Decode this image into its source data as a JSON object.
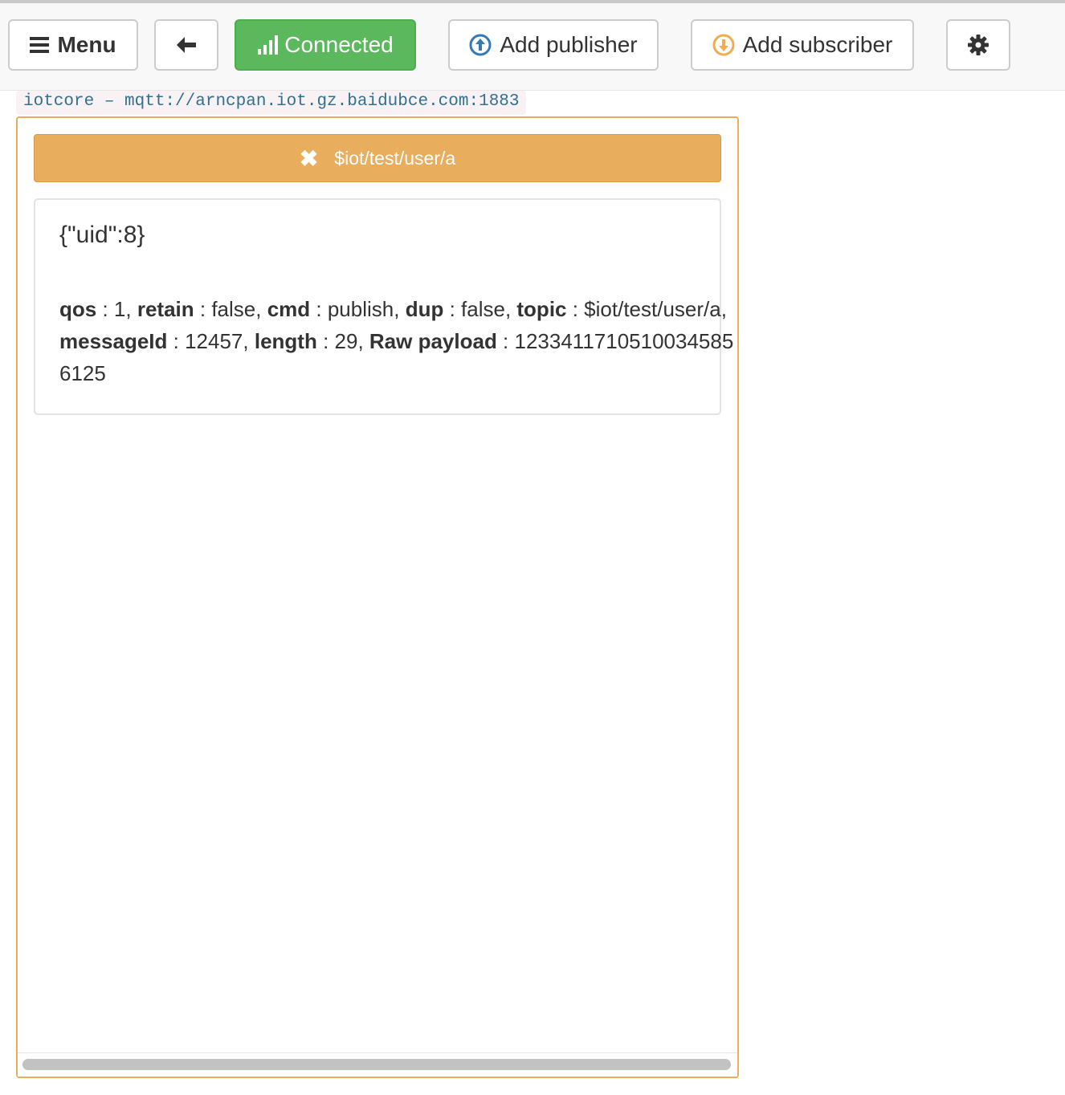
{
  "toolbar": {
    "menu_label": "Menu",
    "back_icon": "arrow-left-icon",
    "connected_label": "Connected",
    "add_publisher_label": "Add publisher",
    "add_subscriber_label": "Add subscriber",
    "settings_icon": "gear-icon"
  },
  "connection": {
    "label": "iotcore – mqtt://arncpan.iot.gz.baidubce.com:1883"
  },
  "subscription": {
    "topic": "$iot/test/user/a",
    "close_icon": "close-icon"
  },
  "message": {
    "payload": "{\"uid\":8}",
    "fields": [
      {
        "key": "qos",
        "value": "1"
      },
      {
        "key": "retain",
        "value": "false"
      },
      {
        "key": "cmd",
        "value": "publish"
      },
      {
        "key": "dup",
        "value": "false"
      },
      {
        "key": "topic",
        "value": "$iot/test/user/a"
      },
      {
        "key": "messageId",
        "value": "12457"
      },
      {
        "key": "length",
        "value": "29"
      },
      {
        "key": "Raw payload",
        "value": "12334117105100345856125"
      }
    ]
  },
  "colors": {
    "connected": "#5cb85c",
    "topic_bar": "#e8ae5d",
    "panel_border": "#e8ad5e",
    "publisher_icon": "#337ab7",
    "subscriber_icon": "#f0ad4e"
  }
}
